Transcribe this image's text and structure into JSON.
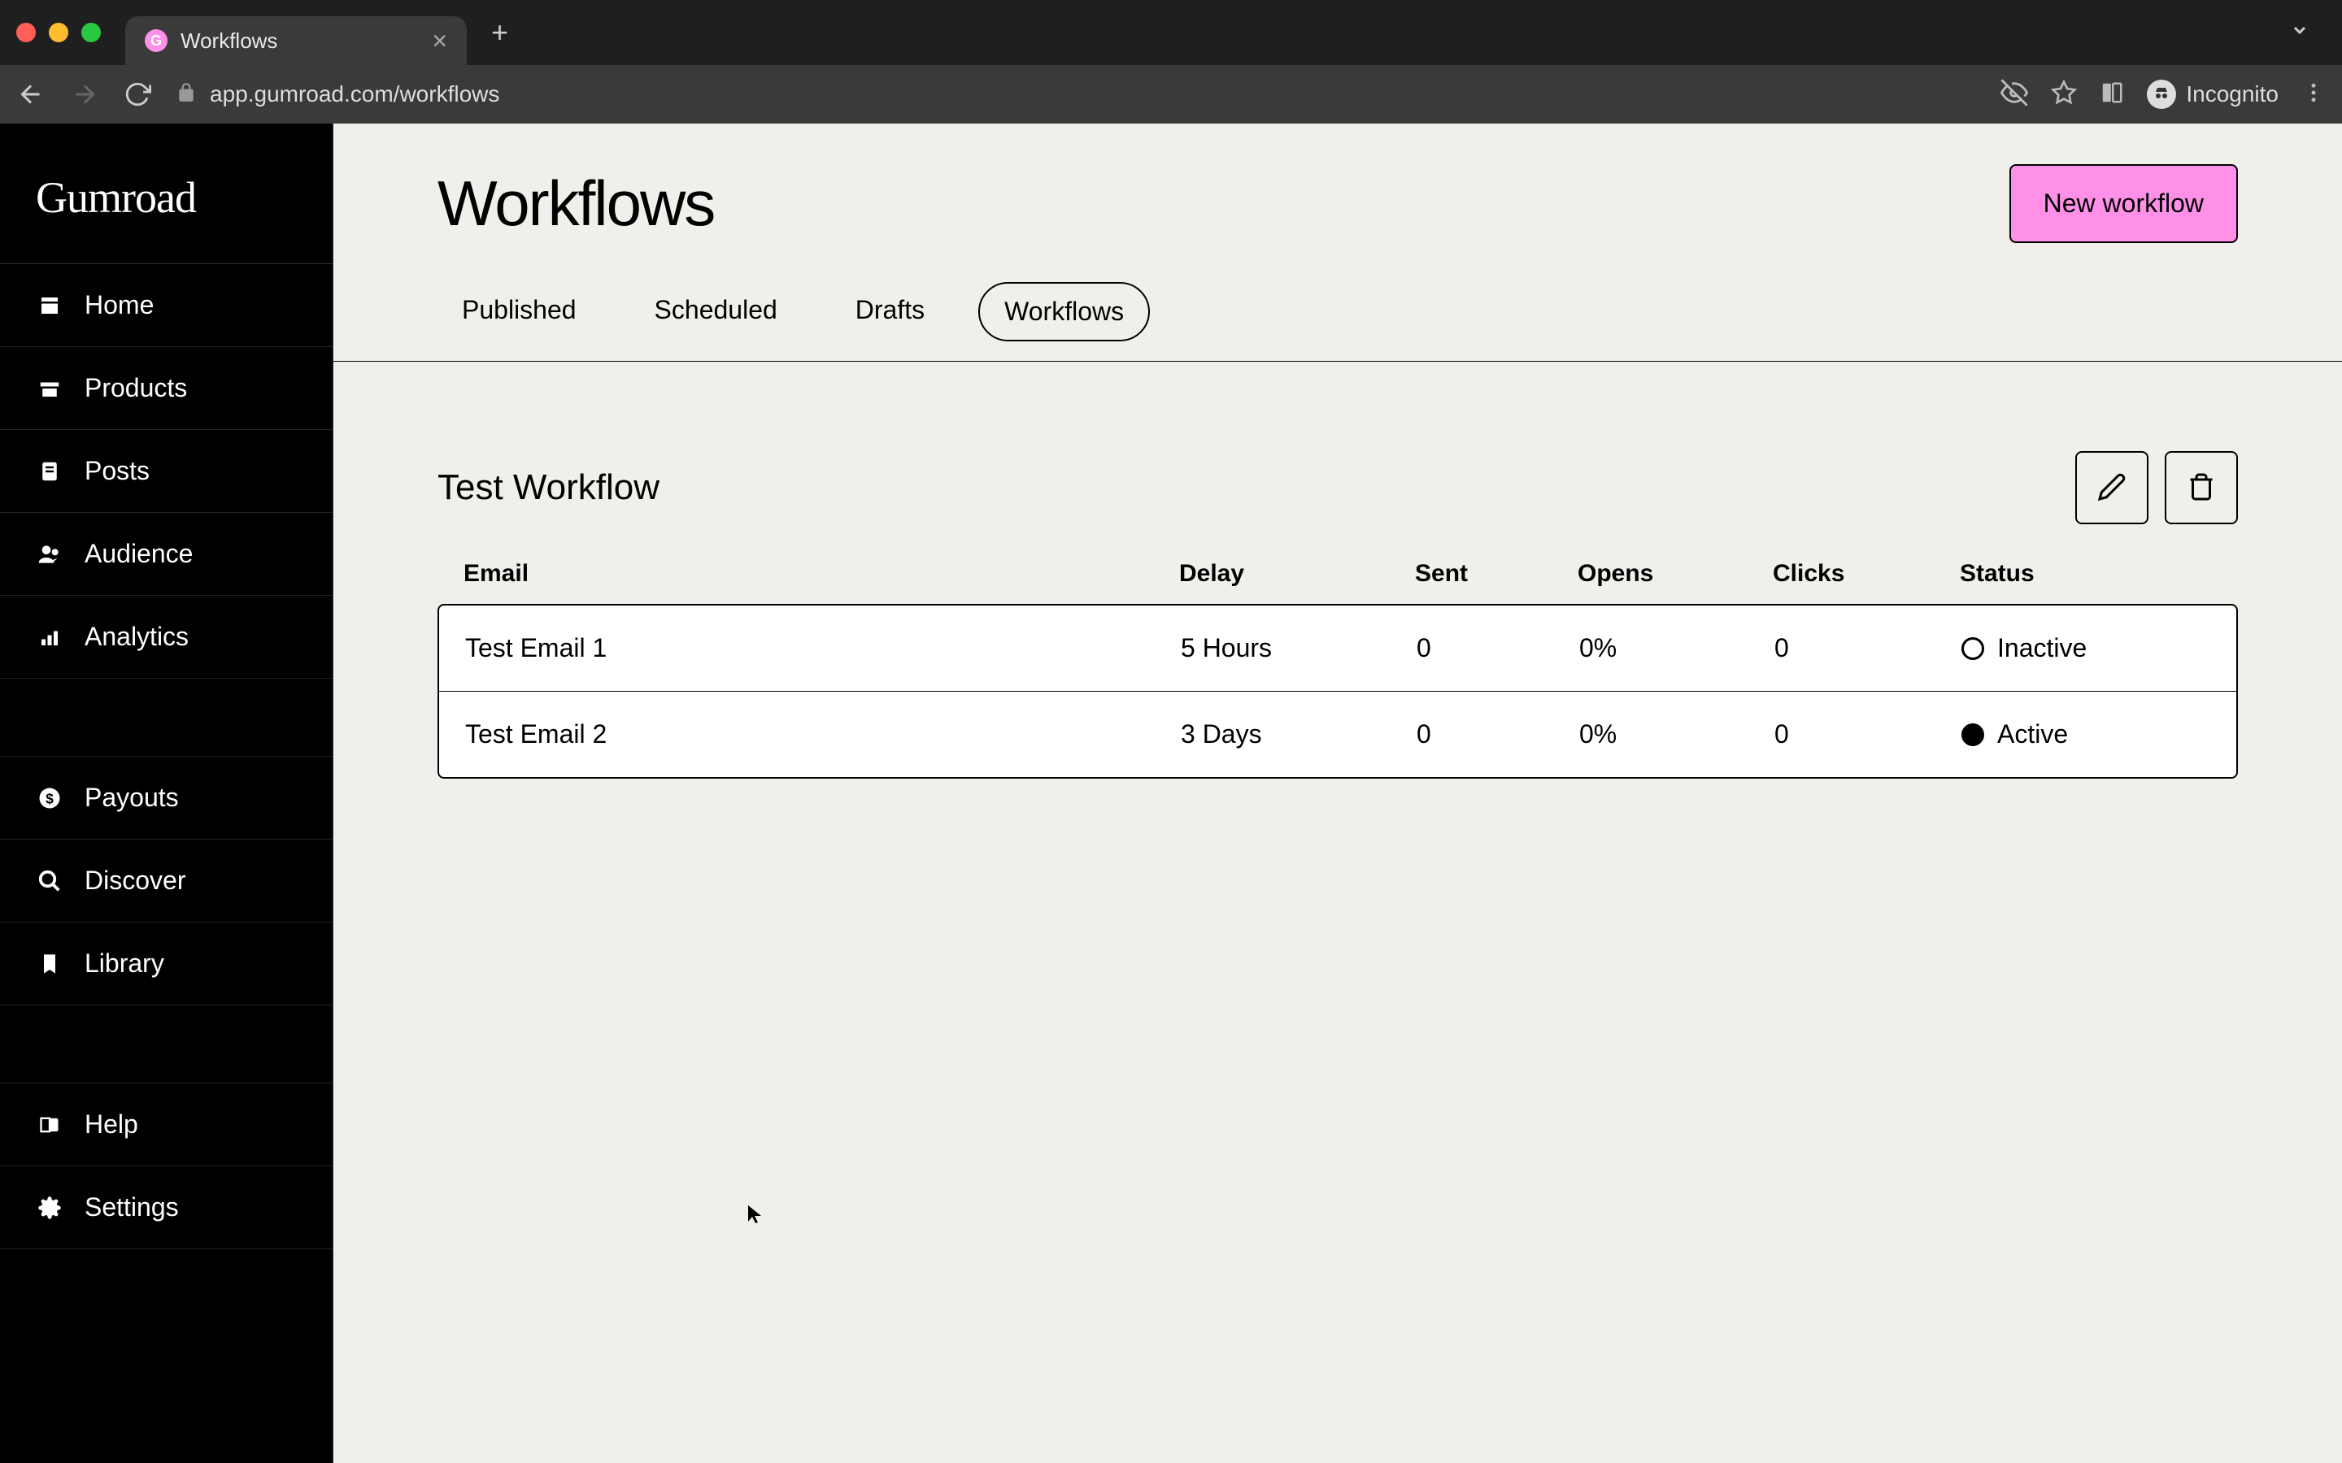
{
  "browser": {
    "tab_title": "Workflows",
    "url": "app.gumroad.com/workflows",
    "profile_label": "Incognito"
  },
  "sidebar": {
    "logo": "Gumroad",
    "nav1": [
      {
        "label": "Home"
      },
      {
        "label": "Products"
      },
      {
        "label": "Posts"
      },
      {
        "label": "Audience"
      },
      {
        "label": "Analytics"
      }
    ],
    "nav2": [
      {
        "label": "Payouts"
      },
      {
        "label": "Discover"
      },
      {
        "label": "Library"
      }
    ],
    "nav3": [
      {
        "label": "Help"
      },
      {
        "label": "Settings"
      }
    ]
  },
  "page": {
    "title": "Workflows",
    "new_button": "New workflow",
    "tabs": [
      {
        "label": "Published",
        "active": false
      },
      {
        "label": "Scheduled",
        "active": false
      },
      {
        "label": "Drafts",
        "active": false
      },
      {
        "label": "Workflows",
        "active": true
      }
    ]
  },
  "workflow": {
    "title": "Test Workflow",
    "columns": {
      "email": "Email",
      "delay": "Delay",
      "sent": "Sent",
      "opens": "Opens",
      "clicks": "Clicks",
      "status": "Status"
    },
    "rows": [
      {
        "email": "Test Email 1",
        "delay": "5 Hours",
        "sent": "0",
        "opens": "0%",
        "clicks": "0",
        "status": "Inactive",
        "status_filled": false
      },
      {
        "email": "Test Email 2",
        "delay": "3 Days",
        "sent": "0",
        "opens": "0%",
        "clicks": "0",
        "status": "Active",
        "status_filled": true
      }
    ]
  }
}
